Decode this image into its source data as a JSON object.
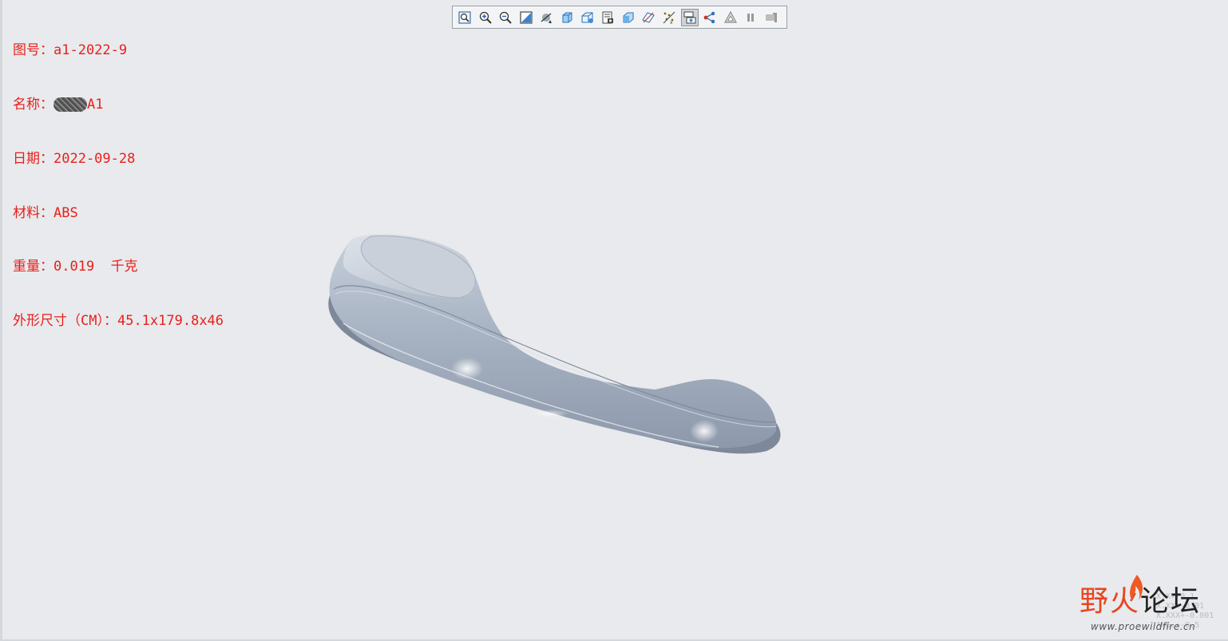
{
  "info": {
    "drawing_no": "图号：a1-2022-9",
    "name_prefix": "名称：",
    "name_suffix": "A1",
    "date": "日期：2022-09-28",
    "material": "材料：ABS",
    "weight": "重量：0.019  千克",
    "dimensions": "外形尺寸（CM）：45.1x179.8x46"
  },
  "toolbar": {
    "buttons": [
      {
        "icon": "refit-icon"
      },
      {
        "icon": "zoom-in-icon"
      },
      {
        "icon": "zoom-out-icon"
      },
      {
        "icon": "repaint-icon"
      },
      {
        "icon": "perspective-icon"
      },
      {
        "icon": "display-style-icon"
      },
      {
        "icon": "saved-orientations-icon"
      },
      {
        "icon": "view-manager-icon"
      },
      {
        "icon": "section-icon"
      },
      {
        "icon": "datum-display-icon"
      },
      {
        "icon": "annotation-display-icon"
      },
      {
        "icon": "spin-center-icon",
        "active": true
      },
      {
        "icon": "connection-icon"
      },
      {
        "icon": "mesh-icon"
      },
      {
        "icon": "pause-icon"
      },
      {
        "icon": "view-extra-icon"
      }
    ]
  },
  "watermark": {
    "title_part1": "野火",
    "title_part2": "论坛",
    "url": "www.proewildfire.cn"
  },
  "tolerance_text": "X.X+-0.1\nX.XX+-0.01\nX.XXX+-0.001\nANG.+-0.5",
  "colors": {
    "info_text": "#e8201c",
    "background": "#e8eaed",
    "model": "#a9b4c4"
  }
}
